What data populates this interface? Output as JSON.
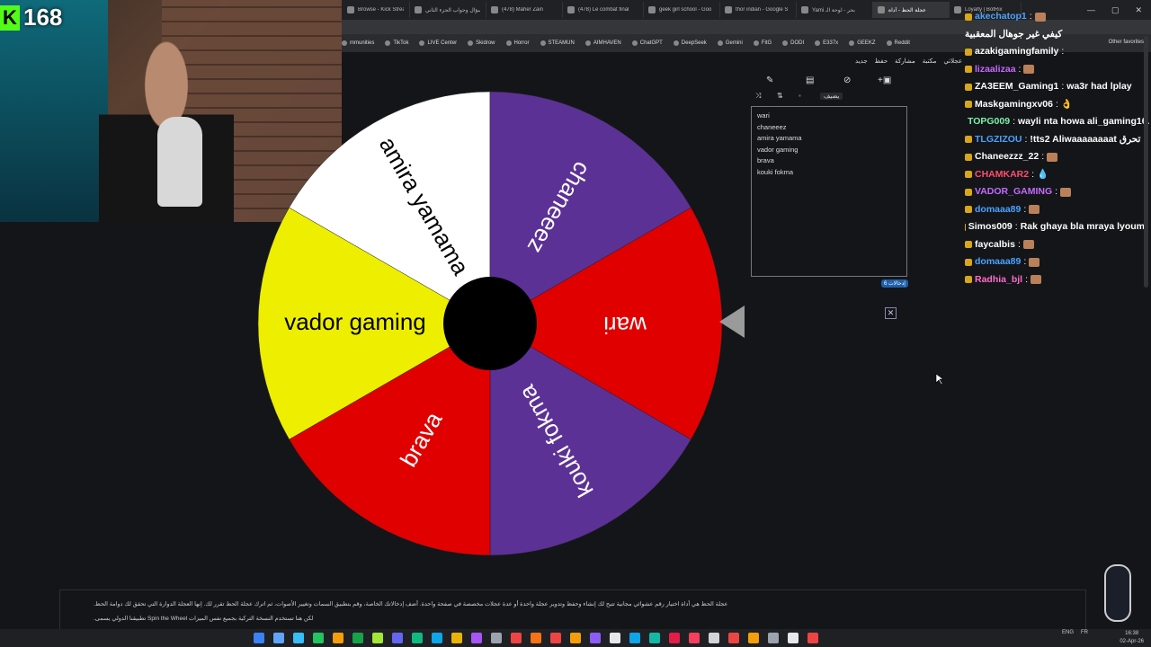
{
  "browser": {
    "tabs": [
      {
        "title": "Browse - Kick Streaming",
        "active": false
      },
      {
        "title": "سؤال وجواب الجزء الثاني",
        "active": false
      },
      {
        "title": "(478) Maher Zain",
        "active": false
      },
      {
        "title": "(478) Le combat final",
        "active": false
      },
      {
        "title": "geek girl school - Goo",
        "active": false
      },
      {
        "title": "thor indian - Google S",
        "active": false
      },
      {
        "title": "Yami بحر - لوحة الـ",
        "active": false
      },
      {
        "title": "عجلة الحظ - أداة",
        "active": true
      },
      {
        "title": "Loyalty | BotRix",
        "active": false
      }
    ],
    "window_controls": [
      "—",
      "▢",
      "✕"
    ],
    "bookmarks": [
      "mmunities",
      "TikTok",
      "LIVE Center",
      "Skidrow",
      "Horror",
      "STEAMUN",
      "AIMHAVEN",
      "ChatGPT",
      "DeepSeek",
      "Gemini",
      "FitG",
      "DODI",
      "E337x",
      "GEEKZ",
      "Reddit"
    ],
    "other_bookmarks": "Other favorites"
  },
  "site_toolbar": [
    "جديد",
    "حفظ",
    "مشاركة",
    "مكتبة",
    "عجلاتي"
  ],
  "webcam": {
    "viewer_count": "168",
    "platform_logo": "K"
  },
  "wheel": {
    "pointer_color": "#9a9a9a",
    "center_color": "#000000",
    "slices": [
      {
        "label": "wari",
        "color": "#e00000",
        "text_color": "#ffffff"
      },
      {
        "label": "kouki fokma",
        "color": "#5c3196",
        "text_color": "#ffffff"
      },
      {
        "label": "brava",
        "color": "#e00000",
        "text_color": "#ffffff"
      },
      {
        "label": "vador gaming",
        "color": "#eeee00",
        "text_color": "#000000"
      },
      {
        "label": "amira yamama",
        "color": "#ffffff",
        "text_color": "#000000"
      },
      {
        "label": "chaneeez",
        "color": "#5c3196",
        "text_color": "#ffffff"
      }
    ]
  },
  "editor": {
    "tool_icons": [
      "pencil-icon",
      "clipboard-icon",
      "hide-icon",
      "add-image-icon",
      "shuffle-icon",
      "sort-icon",
      "lock-icon"
    ],
    "add_button": "يضيف",
    "entries": [
      "wari",
      "chaneeez",
      "amira yamama",
      "vador gaming",
      "brava",
      "kouki fokma"
    ],
    "entries_label": "إدخالات",
    "entries_count": "6"
  },
  "chat": {
    "messages": [
      {
        "user": "akechatop1",
        "text": "",
        "user_color": "#4aa3ff",
        "emote": true
      },
      {
        "user": "",
        "text": "كيفي غير جوهال المعقبية",
        "user_color": "#ffffff",
        "emote": false
      },
      {
        "user": "azakigamingfamily",
        "text": "",
        "user_color": "#ffffff",
        "emote": false
      },
      {
        "user": "lizaalizaa",
        "text": "",
        "user_color": "#c26bff",
        "emote": true
      },
      {
        "user": "ZA3EEM_Gaming1",
        "text": "wa3r had lplay",
        "user_color": "#ffffff",
        "emote": false
      },
      {
        "user": "Maskgamingxv06",
        "text": "👌",
        "user_color": "#ffffff",
        "emote": false
      },
      {
        "user": "TOPG009",
        "text": "wayli nta howa ali_gaming16.",
        "user_color": "#7cf2a7",
        "emote": false
      },
      {
        "user": "TLGZIZOU",
        "text": "!tts2 Aliwaaaaaaaat تحرق",
        "user_color": "#4aa3ff",
        "emote": false
      },
      {
        "user": "Chaneezzz_22",
        "text": "",
        "user_color": "#ffffff",
        "emote": true
      },
      {
        "user": "CHAMKAR2",
        "text": "💧",
        "user_color": "#ff4d6d",
        "emote": false
      },
      {
        "user": "VADOR_GAMING",
        "text": "",
        "user_color": "#c26bff",
        "emote": true
      },
      {
        "user": "domaaa89",
        "text": "",
        "user_color": "#4aa3ff",
        "emote": true
      },
      {
        "user": "Simos009",
        "text": "Rak ghaya bla mraya lyoum",
        "user_color": "#ffffff",
        "emote": false
      },
      {
        "user": "faycalbis",
        "text": "",
        "user_color": "#ffffff",
        "emote": true
      },
      {
        "user": "domaaa89",
        "text": "",
        "user_color": "#4aa3ff",
        "emote": true
      },
      {
        "user": "Radhia_bjl",
        "text": "",
        "user_color": "#ff6bcb",
        "emote": true
      }
    ]
  },
  "info": {
    "line1": "عجلة الحظ هي أداة اختيار رقم عشوائي مجانية تتيح لك إنشاء وحفظ وتدوير عجلة واحدة أو عدة عجلات مخصصة في صفحة واحدة. أضف إدخالاتك الخاصة، وقم بتطبيق السمات وتغيير الأصوات، ثم اترك عجلة الحظ تقرر لك. إنها العجلة الدوارة التي تحقق لك دوامة الحظ.",
    "line2": "لكن هنا تستخدم النسخة التركية بجميع نفس الميزات Spin the Wheel تطبيقنا الدولي يسمى."
  },
  "taskbar": {
    "tray_lang": "ENG",
    "tray_region": "FR",
    "time": "16:38",
    "date": "02-Apr-26"
  }
}
